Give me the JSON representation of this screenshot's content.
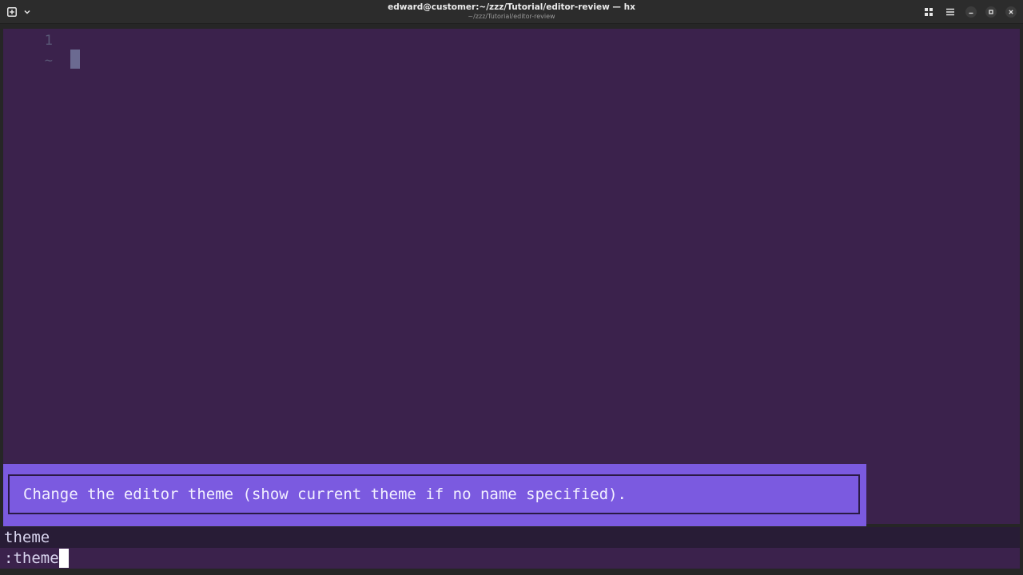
{
  "window": {
    "title": "edward@customer:~/zzz/Tutorial/editor-review — hx",
    "subtitle": "~/zzz/Tutorial/editor-review"
  },
  "editor": {
    "line_numbers": [
      "1"
    ],
    "empty_line_marker": "~"
  },
  "popup": {
    "doc_text": "Change the editor theme (show current theme if no name specified)."
  },
  "completion": {
    "selected_item": "theme"
  },
  "prompt": {
    "text": ":theme"
  },
  "colors": {
    "editor_bg": "#3b224c",
    "popup_bg": "#7b5ae0",
    "completion_bg": "#281c36",
    "titlebar_bg": "#2c2c2c"
  },
  "icons": {
    "new_tab": "new-tab-icon",
    "tab_menu": "chevron-down-icon",
    "layout": "grid-icon",
    "menu": "hamburger-icon",
    "minimize": "minimize-icon",
    "maximize": "maximize-icon",
    "close": "close-icon"
  }
}
